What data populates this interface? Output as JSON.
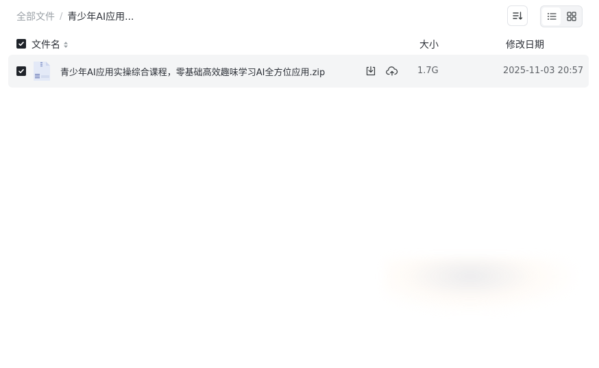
{
  "breadcrumb": {
    "root": "全部文件",
    "separator": "/",
    "current": "青少年AI应用..."
  },
  "toolbar": {
    "sort_icon": "sort-lines-icon",
    "view_list_icon": "list-view-icon",
    "view_grid_icon": "grid-view-icon",
    "active_view": "list"
  },
  "columns": {
    "name": "文件名",
    "size": "大小",
    "date": "修改日期"
  },
  "files": [
    {
      "name": "青少年AI应用实操综合课程，零基础高效趣味学习AI全方位应用.zip",
      "size": "1.7G",
      "modified": "2025-11-03 20:57",
      "selected": true,
      "icon": "zip-file-icon"
    }
  ],
  "colors": {
    "checkbox": "#1f2329",
    "row_bg": "#f4f5f6",
    "muted_text": "#9aa0a6"
  }
}
